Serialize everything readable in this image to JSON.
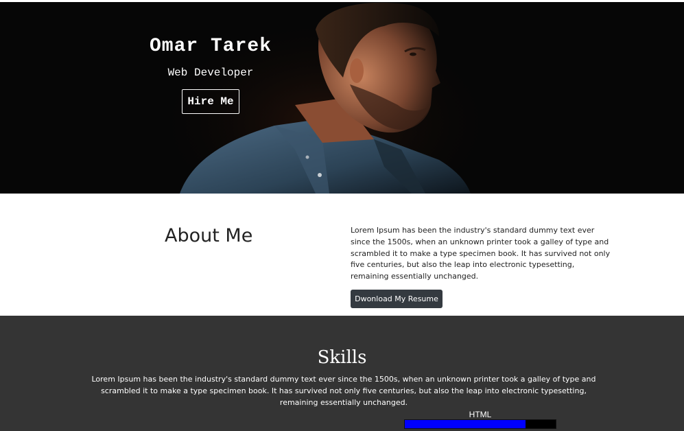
{
  "hero": {
    "name": "Omar Tarek",
    "role": "Web Developer",
    "hire_label": "Hire Me"
  },
  "about": {
    "title": "About Me",
    "text": "Lorem Ipsum has been the industry's standard dummy text ever since the 1500s, when an unknown printer took a galley of type and scrambled it to make a type specimen book. It has survived not only five centuries, but also the leap into electronic typesetting, remaining essentially unchanged.",
    "resume_label": "Dwonload My Resume"
  },
  "skills": {
    "title": "Skills",
    "text": "Lorem Ipsum has been the industry's standard dummy text ever since the 1500s, when an unknown printer took a galley of type and scrambled it to make a type specimen book. It has survived not only five centuries, but also the leap into electronic typesetting, remaining essentially unchanged.",
    "items": [
      {
        "label": "HTML",
        "level": 0.8
      }
    ]
  },
  "colors": {
    "hero_bg": "#060606",
    "skills_bg": "#343434",
    "button_dark": "#343a40",
    "progress_fill": "#0000ff",
    "progress_track": "#000000"
  }
}
